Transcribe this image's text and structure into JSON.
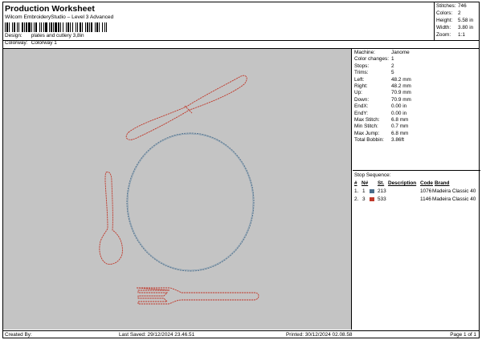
{
  "header": {
    "title": "Production Worksheet",
    "software": "Wilcom EmbroideryStudio – Level 3 Advanced",
    "design_label": "Design:",
    "design_value": "plates and cutlery 3,8in",
    "colorway_label": "Colorway:",
    "colorway_value": "Colorway 1"
  },
  "stats": [
    {
      "label": "Stitches:",
      "value": "746"
    },
    {
      "label": "Colors:",
      "value": "2"
    },
    {
      "label": "Height:",
      "value": "5.58 in"
    },
    {
      "label": "Width:",
      "value": "3.80 in"
    },
    {
      "label": "Zoom:",
      "value": "1:1"
    }
  ],
  "info": [
    {
      "label": "Machine:",
      "value": "Janome"
    },
    {
      "label": "Color changes:",
      "value": "1"
    },
    {
      "label": "Stops:",
      "value": "2"
    },
    {
      "label": "Trims:",
      "value": "5"
    },
    {
      "label": "Left:",
      "value": "48.2 mm"
    },
    {
      "label": "Right:",
      "value": "48.2 mm"
    },
    {
      "label": "Up:",
      "value": "70.9 mm"
    },
    {
      "label": "Down:",
      "value": "70.9 mm"
    },
    {
      "label": "EndX:",
      "value": "0.00 in"
    },
    {
      "label": "EndY:",
      "value": "0.00 in"
    },
    {
      "label": "Max Stitch:",
      "value": "6.8 mm"
    },
    {
      "label": "Min Stitch:",
      "value": "0.7 mm"
    },
    {
      "label": "Max Jump:",
      "value": "6.8 mm"
    },
    {
      "label": "Total Bobbin:",
      "value": "3.86ft"
    }
  ],
  "stop_sequence": {
    "title": "Stop Sequence:",
    "columns": [
      "#",
      "N#",
      "St.",
      "Description",
      "Code",
      "Brand"
    ],
    "rows": [
      {
        "num": "1.",
        "needle": "1",
        "color": "#4a6e8c",
        "stitches": "213",
        "code": "1076",
        "brand": "Madeira Classic 40"
      },
      {
        "num": "2.",
        "needle": "3",
        "color": "#c0392b",
        "stitches": "533",
        "code": "1146",
        "brand": "Madeira Classic 40"
      }
    ]
  },
  "footer": {
    "created_by": "Created By:",
    "last_saved": "Last Saved: 29/12/2024 23.46.51",
    "printed": "Printed: 30/12/2024 02.08.58",
    "page": "Page 1 of 1"
  },
  "colors": {
    "design_background": "#c4c4c4",
    "plate_thread": "#4a6e8c",
    "cutlery_thread": "#c0392b"
  }
}
